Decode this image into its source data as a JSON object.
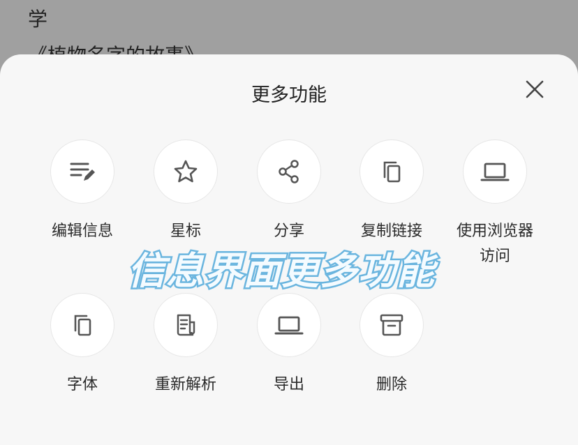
{
  "background": {
    "line1": "学",
    "line2": "《植物名字的故事》"
  },
  "sheet": {
    "title": "更多功能",
    "close_icon": "close-icon",
    "items": [
      {
        "label": "编辑信息",
        "icon": "edit-list-icon"
      },
      {
        "label": "星标",
        "icon": "star-icon"
      },
      {
        "label": "分享",
        "icon": "share-icon"
      },
      {
        "label": "复制链接",
        "icon": "copy-icon"
      },
      {
        "label_line1": "使用浏览器",
        "label_line2": "访问",
        "icon": "laptop-icon"
      },
      {
        "label": "字体",
        "icon": "copy-icon"
      },
      {
        "label": "重新解析",
        "icon": "document-icon"
      },
      {
        "label": "导出",
        "icon": "laptop-icon"
      },
      {
        "label": "删除",
        "icon": "archive-icon"
      }
    ]
  },
  "overlay_caption": "信息界面更多功能",
  "colors": {
    "icon": "#555555",
    "overlay_stroke": "#6db7e0"
  }
}
